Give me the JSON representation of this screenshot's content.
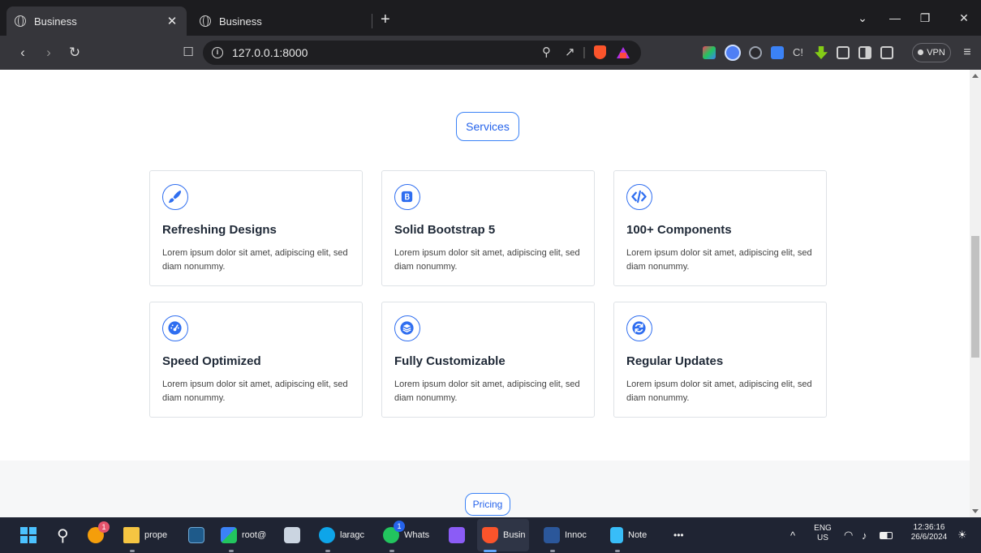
{
  "browser": {
    "tabs": [
      {
        "title": "Business",
        "active": true
      },
      {
        "title": "Business",
        "active": false
      }
    ],
    "new_tab": "+",
    "window_controls": {
      "dropdown": "⌄",
      "minimize": "—",
      "restore": "❐",
      "close": "✕"
    },
    "url": "127.0.0.1:8000",
    "vpn_label": "VPN"
  },
  "services": {
    "label": "Services",
    "cards": [
      {
        "icon": "paintbrush-icon",
        "title": "Refreshing Designs",
        "text": "Lorem ipsum dolor sit amet, adipiscing elit, sed diam nonummy."
      },
      {
        "icon": "bootstrap-icon",
        "title": "Solid Bootstrap 5",
        "text": "Lorem ipsum dolor sit amet, adipiscing elit, sed diam nonummy."
      },
      {
        "icon": "code-icon",
        "title": "100+ Components",
        "text": "Lorem ipsum dolor sit amet, adipiscing elit, sed diam nonummy."
      },
      {
        "icon": "speedometer-icon",
        "title": "Speed Optimized",
        "text": "Lorem ipsum dolor sit amet, adipiscing elit, sed diam nonummy."
      },
      {
        "icon": "layers-icon",
        "title": "Fully Customizable",
        "text": "Lorem ipsum dolor sit amet, adipiscing elit, sed diam nonummy."
      },
      {
        "icon": "refresh-icon",
        "title": "Regular Updates",
        "text": "Lorem ipsum dolor sit amet, adipiscing elit, sed diam nonummy."
      }
    ]
  },
  "pricing": {
    "label": "Pricing"
  },
  "taskbar": {
    "apps": [
      {
        "label": "prope"
      },
      {
        "label": "root@"
      },
      {
        "label": "laragc"
      },
      {
        "label": "Whats"
      },
      {
        "label": "Busin"
      },
      {
        "label": "Innoc"
      },
      {
        "label": "Note"
      }
    ],
    "more": "•••",
    "badges": {
      "app1": "1",
      "whatsapp": "1"
    },
    "lang": "ENG",
    "region": "US",
    "time": "12:36:16",
    "date": "26/6/2024",
    "tray_chevron": "^"
  },
  "colors": {
    "accent": "#2f6ef0",
    "tabbar": "#1c1c1f",
    "toolbar": "#36363b",
    "taskbar": "#1f2433"
  }
}
